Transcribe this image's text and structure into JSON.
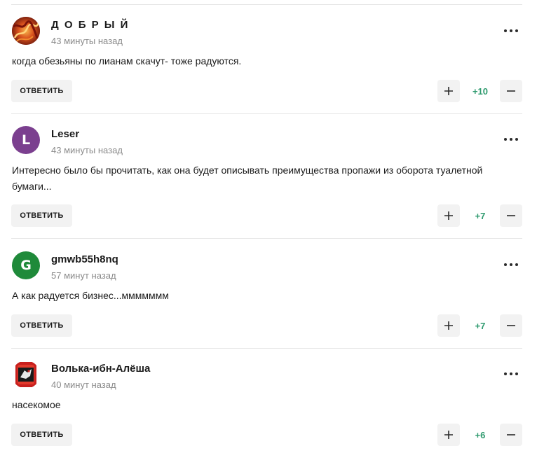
{
  "comments": [
    {
      "author": "Д О Б Р Ы Й",
      "time": "43 минуты назад",
      "text": "когда обезьяны по лианам скачут- тоже радуются.",
      "reply_label": "ОТВЕТИТЬ",
      "score": "+10",
      "avatar": {
        "type": "image",
        "bg": "#b8381e"
      }
    },
    {
      "author": "Leser",
      "time": "43 минуты назад",
      "text": "Интересно было бы прочитать, как она будет описывать преимущества пропажи из оборота туалетной бумаги...",
      "reply_label": "ОТВЕТИТЬ",
      "score": "+7",
      "avatar": {
        "type": "letter",
        "letter": "L",
        "bg": "#7b3f8f"
      }
    },
    {
      "author": "gmwb55h8nq",
      "time": "57 минут назад",
      "text": "А как радуется бизнес...ммммммм",
      "reply_label": "ОТВЕТИТЬ",
      "score": "+7",
      "avatar": {
        "type": "letter",
        "letter": "G",
        "bg": "#1f8a3a"
      }
    },
    {
      "author": "Волька-ибн-Алёша",
      "time": "40 минут назад",
      "text": "насекомое",
      "reply_label": "ОТВЕТИТЬ",
      "score": "+6",
      "avatar": {
        "type": "image",
        "bg": "#c8201e"
      }
    }
  ],
  "colors": {
    "score": "#2e9a6e",
    "button_bg": "#f2f2f2",
    "divider": "#e6e6e6",
    "time": "#8a8a8a"
  },
  "icons": {
    "more": "more-dots-icon",
    "upvote": "plus-icon",
    "downvote": "minus-icon"
  }
}
